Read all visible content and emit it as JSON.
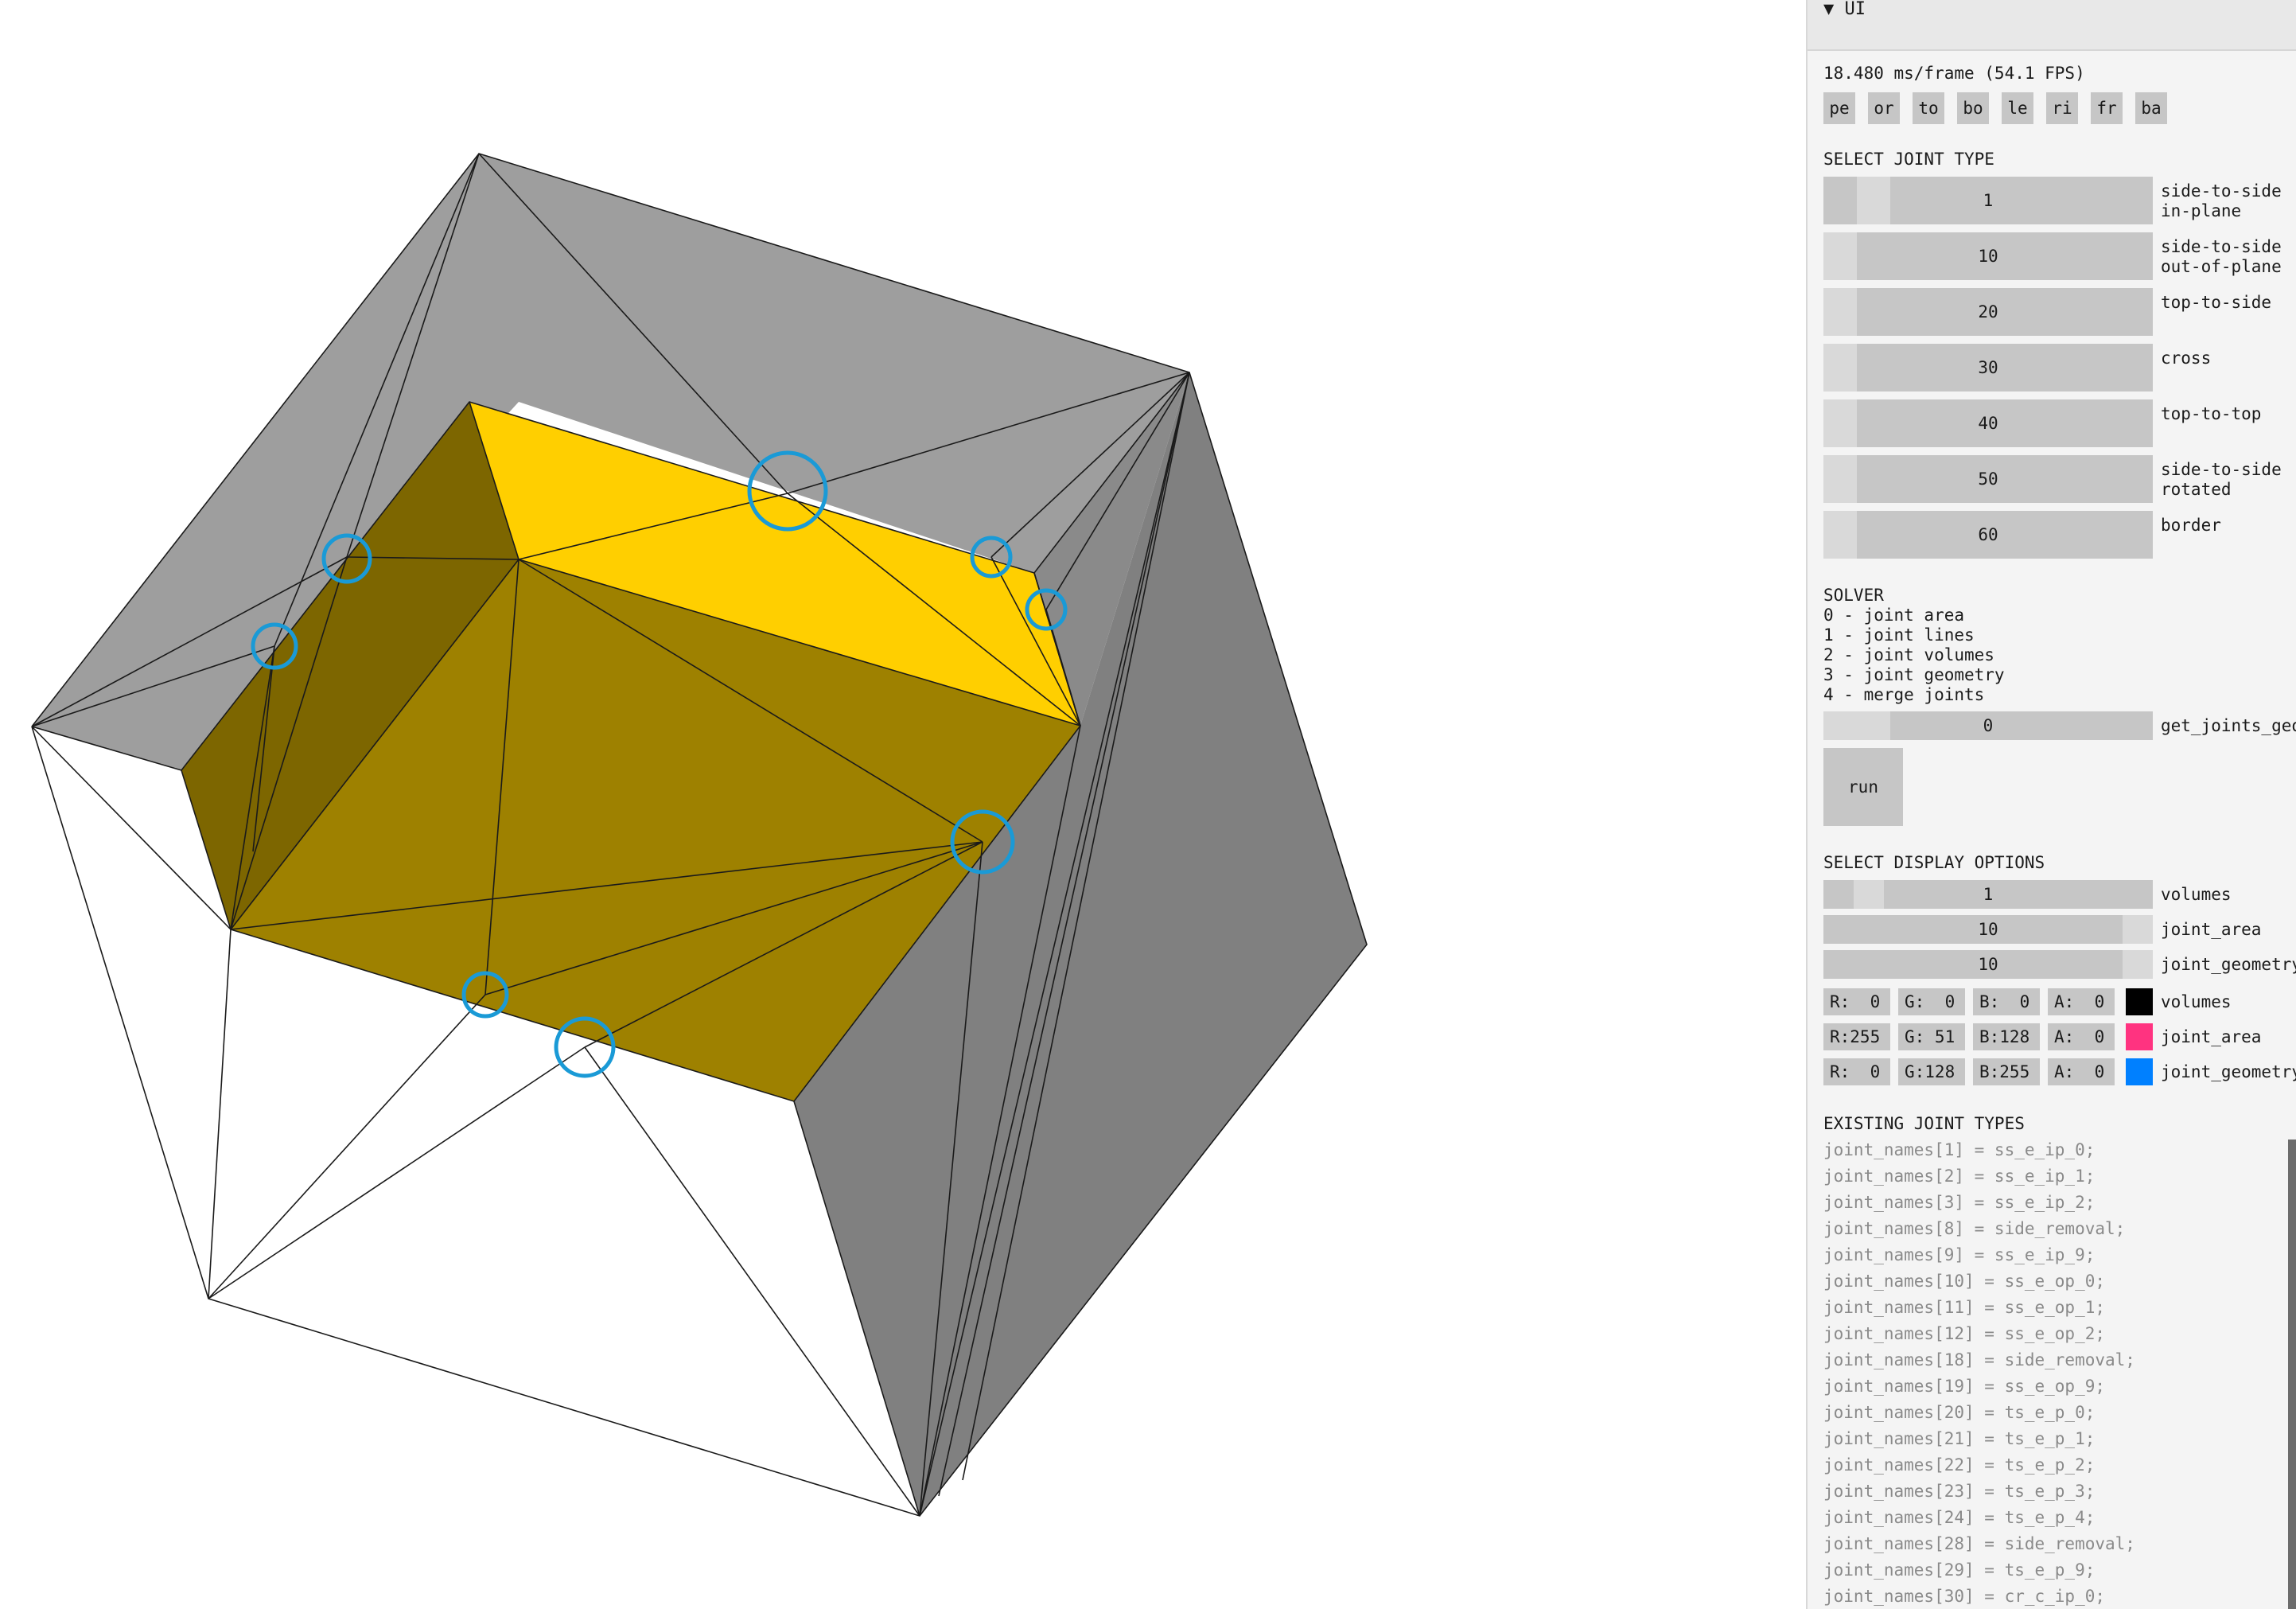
{
  "panel": {
    "title": "UI",
    "collapse_icon": "triangle-down-icon",
    "fps": "18.480 ms/frame (54.1 FPS)",
    "view_buttons": [
      "pe",
      "or",
      "to",
      "bo",
      "le",
      "ri",
      "fr",
      "ba"
    ],
    "joint_type": {
      "heading": "SELECT JOINT TYPE",
      "sliders": [
        {
          "value": "1",
          "label1": "side-to-side",
          "label2": "in-plane"
        },
        {
          "value": "10",
          "label1": "side-to-side",
          "label2": "out-of-plane"
        },
        {
          "value": "20",
          "label1": "top-to-side",
          "label2": ""
        },
        {
          "value": "30",
          "label1": "cross",
          "label2": ""
        },
        {
          "value": "40",
          "label1": "top-to-top",
          "label2": ""
        },
        {
          "value": "50",
          "label1": "side-to-side",
          "label2": "rotated"
        },
        {
          "value": "60",
          "label1": "border",
          "label2": ""
        }
      ]
    },
    "solver": {
      "heading": "SOLVER",
      "options": [
        "0 - joint area",
        "1 - joint lines",
        "2 - joint volumes",
        "3 - joint geometry",
        "4 - merge joints"
      ],
      "slider_value": "0",
      "slider_label": "get_joints_geometry",
      "run_label": "run"
    },
    "display": {
      "heading": "SELECT DISPLAY OPTIONS",
      "sliders": [
        {
          "value": "1",
          "label": "volumes"
        },
        {
          "value": "10",
          "label": "joint_area"
        },
        {
          "value": "10",
          "label": "joint_geometry"
        }
      ],
      "colors": [
        {
          "r": "R:  0",
          "g": "G:  0",
          "b": "B:  0",
          "a": "A:  0",
          "swatch": "#000000",
          "label": "volumes"
        },
        {
          "r": "R:255",
          "g": "G: 51",
          "b": "B:128",
          "a": "A:  0",
          "swatch": "#ff3380",
          "label": "joint_area"
        },
        {
          "r": "R:  0",
          "g": "G:128",
          "b": "B:255",
          "a": "A:  0",
          "swatch": "#0080ff",
          "label": "joint_geometry"
        }
      ]
    },
    "existing": {
      "heading": "EXISTING JOINT TYPES",
      "lines": [
        "joint_names[1] = ss_e_ip_0;",
        "joint_names[2] = ss_e_ip_1;",
        "joint_names[3] = ss_e_ip_2;",
        "joint_names[8] = side_removal;",
        "joint_names[9] = ss_e_ip_9;",
        "joint_names[10] = ss_e_op_0;",
        "joint_names[11] = ss_e_op_1;",
        "joint_names[12] = ss_e_op_2;",
        "joint_names[18] = side_removal;",
        "joint_names[19] = ss_e_op_9;",
        "joint_names[20] = ts_e_p_0;",
        "joint_names[21] = ts_e_p_1;",
        "joint_names[22] = ts_e_p_2;",
        "joint_names[23] = ts_e_p_3;",
        "joint_names[24] = ts_e_p_4;",
        "joint_names[28] = side_removal;",
        "joint_names[29] = ts_e_p_9;",
        "joint_names[30] = cr_c_ip_0;"
      ]
    }
  },
  "viewport": {
    "colors": {
      "top_face": "#9e9e9e",
      "right_face": "#808080",
      "white_face": "#ffffff",
      "yellow_light": "#ffcf00",
      "yellow_dark": "#9e8100",
      "yellow_darker": "#7d6600",
      "marker": "#1a9ad6",
      "edge": "#1a1a1a"
    }
  }
}
